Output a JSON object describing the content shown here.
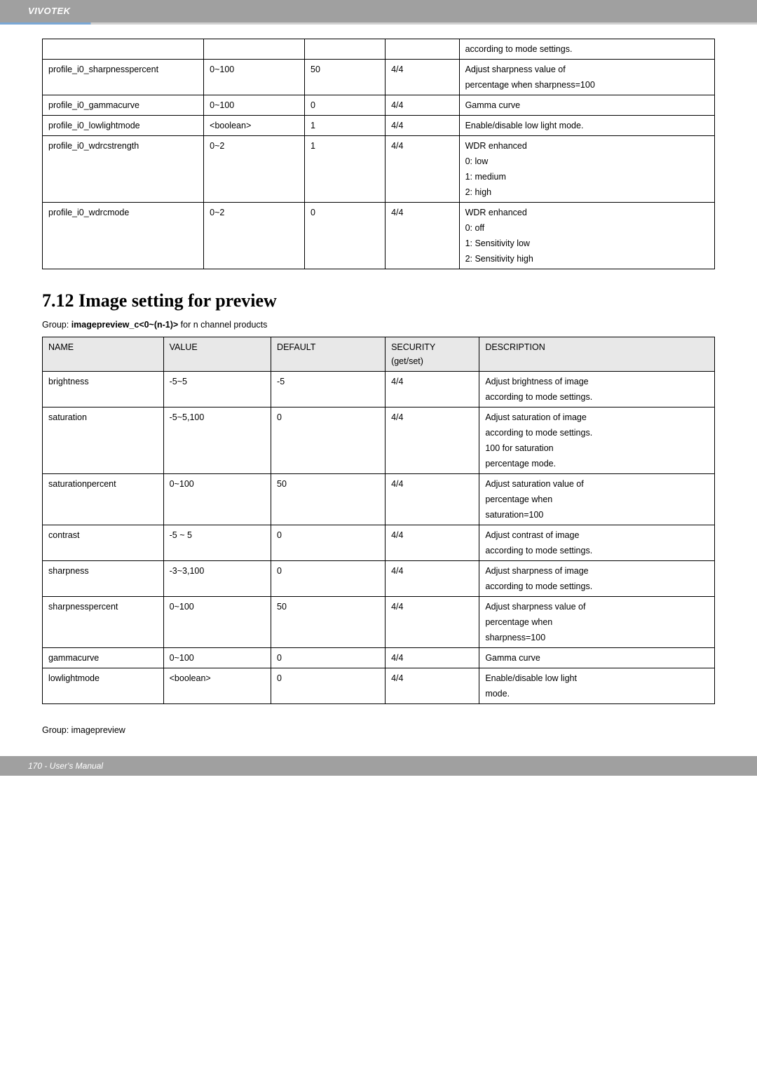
{
  "header": {
    "brand": "VIVOTEK"
  },
  "table1": {
    "rows": [
      {
        "name": "",
        "value": "",
        "default": "",
        "security": "",
        "desc": "according to mode settings."
      },
      {
        "name": "profile_i0_sharpnesspercent",
        "value": "0~100",
        "default": "50",
        "security": "4/4",
        "desc_lines": [
          "Adjust sharpness value of",
          "percentage when sharpness=100"
        ]
      },
      {
        "name": "profile_i0_gammacurve",
        "value": "0~100",
        "default": "0",
        "security": "4/4",
        "desc": "Gamma curve"
      },
      {
        "name": "profile_i0_lowlightmode",
        "value": "<boolean>",
        "default": "1",
        "security": "4/4",
        "desc": "Enable/disable low light mode."
      },
      {
        "name": "profile_i0_wdrcstrength",
        "value": "0~2",
        "default": "1",
        "security": "4/4",
        "desc_lines": [
          "WDR enhanced",
          "0: low",
          "1: medium",
          "2: high"
        ]
      },
      {
        "name": "profile_i0_wdrcmode",
        "value": "0~2",
        "default": "0",
        "security": "4/4",
        "desc_lines": [
          "WDR enhanced",
          "0: off",
          "1: Sensitivity low",
          "2: Sensitivity high"
        ]
      }
    ]
  },
  "section": {
    "title": "7.12 Image setting for preview",
    "group_prefix": "Group: ",
    "group_bold": "imagepreview_c<0~(n-1)>",
    "group_suffix": " for n channel products"
  },
  "table2": {
    "headers": {
      "name": "NAME",
      "value": "VALUE",
      "default": "DEFAULT",
      "security": "SECURITY",
      "security_sub": "(get/set)",
      "desc": "DESCRIPTION"
    },
    "rows": [
      {
        "name": "brightness",
        "value": "-5~5",
        "default": "-5",
        "security": "4/4",
        "desc_lines": [
          "Adjust brightness of image",
          "according to mode settings."
        ]
      },
      {
        "name": "saturation",
        "value": "-5~5,100",
        "default": "0",
        "security": "4/4",
        "desc_lines": [
          "Adjust saturation of image",
          "according to mode settings.",
          "100 for saturation",
          "percentage mode."
        ]
      },
      {
        "name": "saturationpercent",
        "value": "0~100",
        "default": "50",
        "security": "4/4",
        "desc_lines": [
          "Adjust saturation value of",
          "percentage when",
          "saturation=100"
        ]
      },
      {
        "name": "contrast",
        "value": "-5 ~ 5",
        "default": "0",
        "security": "4/4",
        "desc_lines": [
          "Adjust contrast of image",
          "according to mode settings."
        ]
      },
      {
        "name": "sharpness",
        "value": "-3~3,100",
        "default": "0",
        "security": "4/4",
        "desc_lines": [
          "Adjust sharpness of image",
          "according to mode settings."
        ]
      },
      {
        "name": "sharpnesspercent",
        "value": "0~100",
        "default": "50",
        "security": "4/4",
        "desc_lines": [
          "Adjust sharpness value of",
          "percentage when",
          "sharpness=100"
        ]
      },
      {
        "name": "gammacurve",
        "value": "0~100",
        "default": "0",
        "security": "4/4",
        "desc": "Gamma curve"
      },
      {
        "name": "lowlightmode",
        "value": "<boolean>",
        "default": "0",
        "security": "4/4",
        "desc_lines": [
          "Enable/disable low light",
          "mode."
        ]
      }
    ]
  },
  "bottom_group": "Group: imagepreview",
  "footer": {
    "page_label": "170 - User's Manual"
  }
}
